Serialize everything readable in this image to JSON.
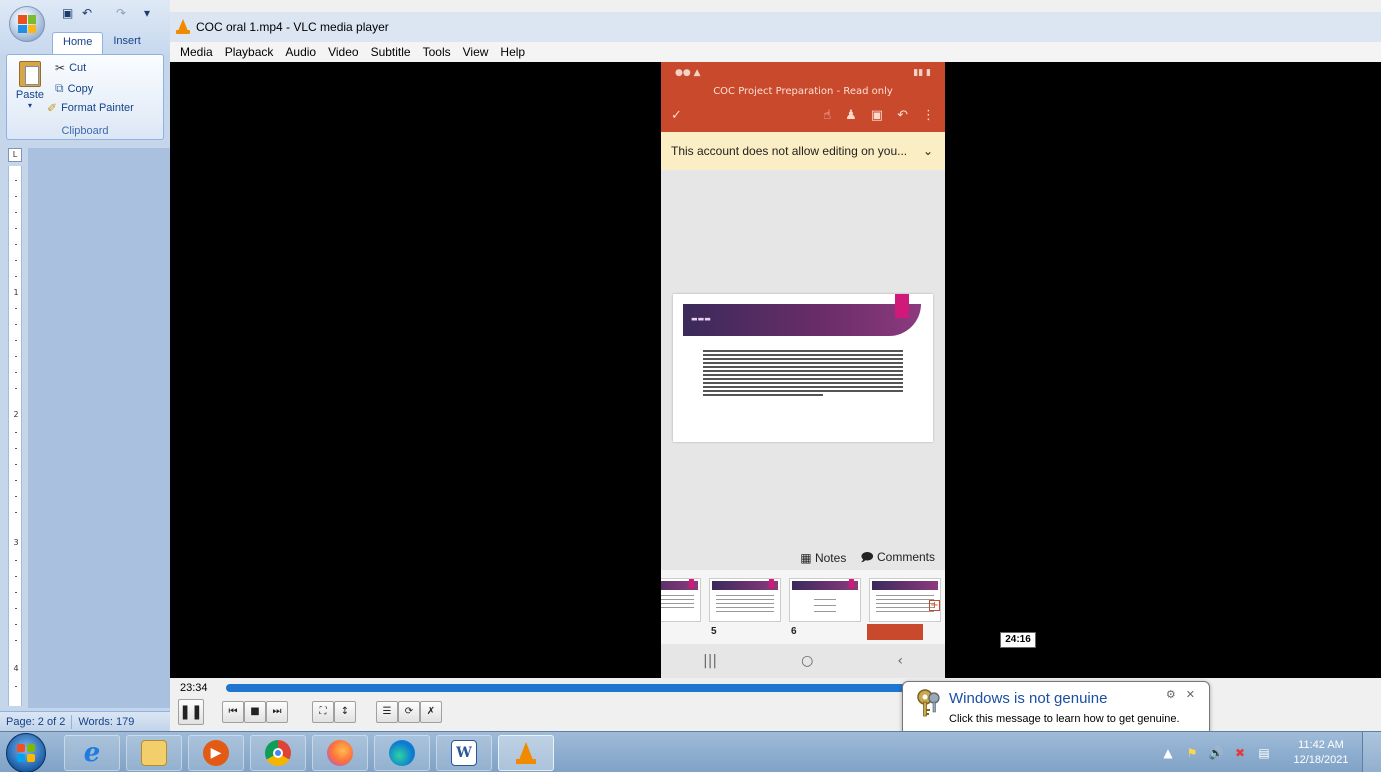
{
  "word": {
    "ribbon_tabs": [
      "Home",
      "Insert"
    ],
    "clipboard": {
      "paste_label": "Paste",
      "cut_label": "Cut",
      "copy_label": "Copy",
      "format_painter_label": "Format Painter",
      "group_label": "Clipboard"
    },
    "ruler_numbers": [
      "1",
      "2",
      "3",
      "4"
    ],
    "status": {
      "page": "Page: 2 of 2",
      "words": "Words: 179"
    }
  },
  "vlc": {
    "title": "COC oral 1.mp4 - VLC media player",
    "menu": [
      "Media",
      "Playback",
      "Audio",
      "Video",
      "Subtitle",
      "Tools",
      "View",
      "Help"
    ],
    "current_time": "23:34",
    "hover_time": "24:16",
    "progress_fraction": 0.8
  },
  "phone": {
    "doc_title": "COC Project Preparation - Read only",
    "notice": "This account does not allow editing on you...",
    "notes_label": "Notes",
    "comments_label": "Comments",
    "thumb_numbers": [
      "5",
      "6"
    ]
  },
  "balloon": {
    "title": "Windows is not genuine",
    "message": "Click this message to learn how to get genuine."
  },
  "taskbar": {
    "clock_time": "11:42 AM",
    "clock_date": "12/18/2021"
  },
  "colors": {
    "vlc_orange": "#f08a00",
    "seek_blue": "#1f76d2",
    "ppt_red": "#c8492b",
    "notice_yellow": "#fbeec4"
  }
}
